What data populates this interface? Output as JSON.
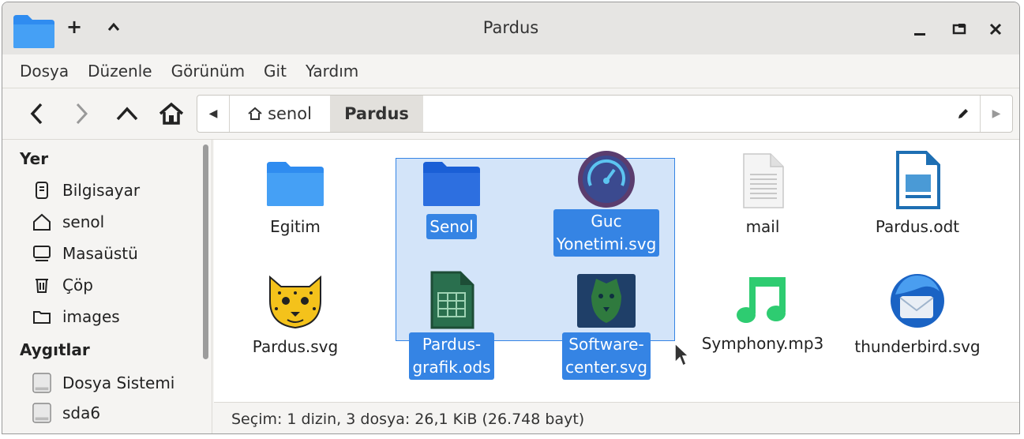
{
  "window": {
    "title": "Pardus"
  },
  "menu": [
    "Dosya",
    "Düzenle",
    "Görünüm",
    "Git",
    "Yardım"
  ],
  "pathbar": {
    "home_label": "senol",
    "current": "Pardus"
  },
  "sidebar": {
    "places_header": "Yer",
    "places": [
      {
        "label": "Bilgisayar",
        "icon": "computer-icon"
      },
      {
        "label": "senol",
        "icon": "home-icon"
      },
      {
        "label": "Masaüstü",
        "icon": "desktop-icon"
      },
      {
        "label": "Çöp",
        "icon": "trash-icon"
      },
      {
        "label": "images",
        "icon": "folder-icon"
      }
    ],
    "devices_header": "Aygıtlar",
    "devices": [
      {
        "label": "Dosya Sistemi",
        "icon": "drive-icon"
      },
      {
        "label": "sda6",
        "icon": "drive-icon"
      }
    ]
  },
  "files": [
    {
      "name": "Egitim",
      "icon": "folder-icon",
      "selected": false
    },
    {
      "name": "Senol",
      "icon": "folder-icon",
      "selected": true
    },
    {
      "name": "Guc Yonetimi.svg",
      "line1": "Guc",
      "line2": "Yonetimi.svg",
      "icon": "power-manager-icon",
      "selected": true
    },
    {
      "name": "mail",
      "icon": "text-document-icon",
      "selected": false
    },
    {
      "name": "Pardus.odt",
      "icon": "writer-document-icon",
      "selected": false
    },
    {
      "name": "Pardus.svg",
      "icon": "cheetah-icon",
      "selected": false
    },
    {
      "name": "Pardus-grafik.ods",
      "line1": "Pardus-",
      "line2": "grafik.ods",
      "icon": "spreadsheet-icon",
      "selected": true
    },
    {
      "name": "Software-center.svg",
      "line1": "Software-",
      "line2": "center.svg",
      "icon": "software-center-icon",
      "selected": true
    },
    {
      "name": "Symphony.mp3",
      "icon": "music-icon",
      "selected": false
    },
    {
      "name": "thunderbird.svg",
      "icon": "thunderbird-icon",
      "selected": false
    }
  ],
  "status": "Seçim: 1 dizin, 3 dosya: 26,1 KiB (26.748 bayt)",
  "colors": {
    "selection": "#3584e4",
    "folder": "#2f8cf0"
  }
}
